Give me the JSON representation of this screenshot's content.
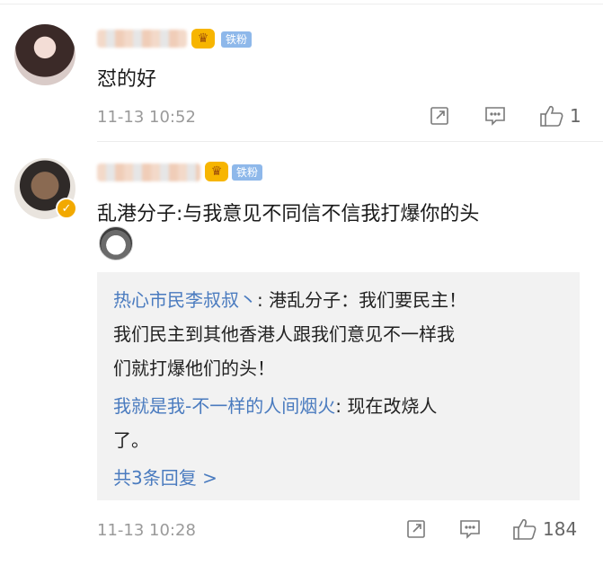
{
  "comments": [
    {
      "badge": "铁粉",
      "text": "怼的好",
      "time": "11-13 10:52",
      "likes": "1"
    },
    {
      "badge": "铁粉",
      "text": "乱港分子:与我意见不同信不信我打爆你的头",
      "time": "11-13 10:28",
      "likes": "184",
      "verified_mark": "✓",
      "replies": [
        {
          "user": "热心市民李叔叔丶",
          "line1": ": 港乱分子：我们要民主！",
          "line2": "我们民主到其他香港人跟我们意见不一样我",
          "line3": "们就打爆他们的头！"
        },
        {
          "user": "我就是我-不一样的人间烟火",
          "line1": ": 现在改烧人",
          "line2": "了。"
        }
      ],
      "more_replies": "共3条回复 >"
    }
  ],
  "icons": {
    "share": "share-icon",
    "comment": "comment-icon",
    "like": "thumbs-up-icon",
    "crown": "crown-icon",
    "emoji": "husky-emoji-icon"
  },
  "colors": {
    "link": "#4a7bbf",
    "badge": "#8eb8ea",
    "crown": "#f7b500",
    "meta": "#9a9a9a"
  }
}
